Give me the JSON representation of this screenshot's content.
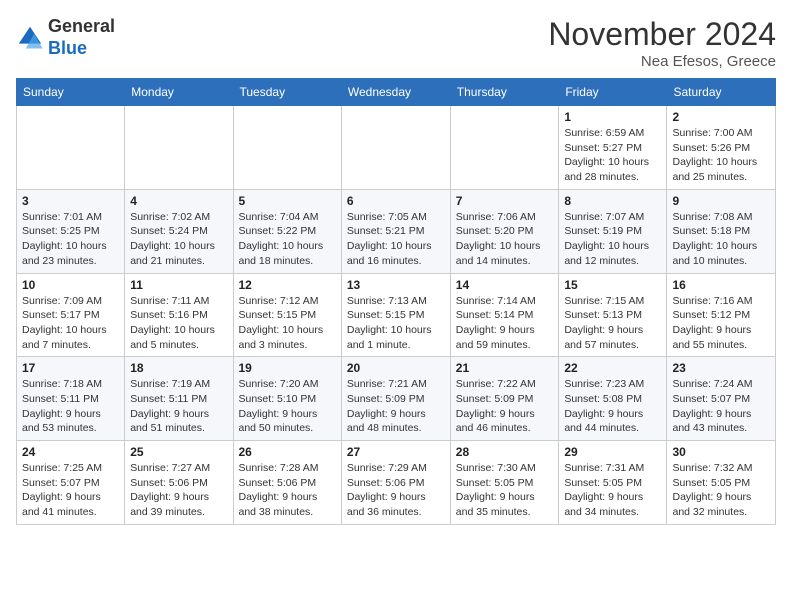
{
  "header": {
    "logo_general": "General",
    "logo_blue": "Blue",
    "month_title": "November 2024",
    "subtitle": "Nea Efesos, Greece"
  },
  "weekdays": [
    "Sunday",
    "Monday",
    "Tuesday",
    "Wednesday",
    "Thursday",
    "Friday",
    "Saturday"
  ],
  "weeks": [
    [
      {
        "day": "",
        "info": ""
      },
      {
        "day": "",
        "info": ""
      },
      {
        "day": "",
        "info": ""
      },
      {
        "day": "",
        "info": ""
      },
      {
        "day": "",
        "info": ""
      },
      {
        "day": "1",
        "info": "Sunrise: 6:59 AM\nSunset: 5:27 PM\nDaylight: 10 hours and 28 minutes."
      },
      {
        "day": "2",
        "info": "Sunrise: 7:00 AM\nSunset: 5:26 PM\nDaylight: 10 hours and 25 minutes."
      }
    ],
    [
      {
        "day": "3",
        "info": "Sunrise: 7:01 AM\nSunset: 5:25 PM\nDaylight: 10 hours and 23 minutes."
      },
      {
        "day": "4",
        "info": "Sunrise: 7:02 AM\nSunset: 5:24 PM\nDaylight: 10 hours and 21 minutes."
      },
      {
        "day": "5",
        "info": "Sunrise: 7:04 AM\nSunset: 5:22 PM\nDaylight: 10 hours and 18 minutes."
      },
      {
        "day": "6",
        "info": "Sunrise: 7:05 AM\nSunset: 5:21 PM\nDaylight: 10 hours and 16 minutes."
      },
      {
        "day": "7",
        "info": "Sunrise: 7:06 AM\nSunset: 5:20 PM\nDaylight: 10 hours and 14 minutes."
      },
      {
        "day": "8",
        "info": "Sunrise: 7:07 AM\nSunset: 5:19 PM\nDaylight: 10 hours and 12 minutes."
      },
      {
        "day": "9",
        "info": "Sunrise: 7:08 AM\nSunset: 5:18 PM\nDaylight: 10 hours and 10 minutes."
      }
    ],
    [
      {
        "day": "10",
        "info": "Sunrise: 7:09 AM\nSunset: 5:17 PM\nDaylight: 10 hours and 7 minutes."
      },
      {
        "day": "11",
        "info": "Sunrise: 7:11 AM\nSunset: 5:16 PM\nDaylight: 10 hours and 5 minutes."
      },
      {
        "day": "12",
        "info": "Sunrise: 7:12 AM\nSunset: 5:15 PM\nDaylight: 10 hours and 3 minutes."
      },
      {
        "day": "13",
        "info": "Sunrise: 7:13 AM\nSunset: 5:15 PM\nDaylight: 10 hours and 1 minute."
      },
      {
        "day": "14",
        "info": "Sunrise: 7:14 AM\nSunset: 5:14 PM\nDaylight: 9 hours and 59 minutes."
      },
      {
        "day": "15",
        "info": "Sunrise: 7:15 AM\nSunset: 5:13 PM\nDaylight: 9 hours and 57 minutes."
      },
      {
        "day": "16",
        "info": "Sunrise: 7:16 AM\nSunset: 5:12 PM\nDaylight: 9 hours and 55 minutes."
      }
    ],
    [
      {
        "day": "17",
        "info": "Sunrise: 7:18 AM\nSunset: 5:11 PM\nDaylight: 9 hours and 53 minutes."
      },
      {
        "day": "18",
        "info": "Sunrise: 7:19 AM\nSunset: 5:11 PM\nDaylight: 9 hours and 51 minutes."
      },
      {
        "day": "19",
        "info": "Sunrise: 7:20 AM\nSunset: 5:10 PM\nDaylight: 9 hours and 50 minutes."
      },
      {
        "day": "20",
        "info": "Sunrise: 7:21 AM\nSunset: 5:09 PM\nDaylight: 9 hours and 48 minutes."
      },
      {
        "day": "21",
        "info": "Sunrise: 7:22 AM\nSunset: 5:09 PM\nDaylight: 9 hours and 46 minutes."
      },
      {
        "day": "22",
        "info": "Sunrise: 7:23 AM\nSunset: 5:08 PM\nDaylight: 9 hours and 44 minutes."
      },
      {
        "day": "23",
        "info": "Sunrise: 7:24 AM\nSunset: 5:07 PM\nDaylight: 9 hours and 43 minutes."
      }
    ],
    [
      {
        "day": "24",
        "info": "Sunrise: 7:25 AM\nSunset: 5:07 PM\nDaylight: 9 hours and 41 minutes."
      },
      {
        "day": "25",
        "info": "Sunrise: 7:27 AM\nSunset: 5:06 PM\nDaylight: 9 hours and 39 minutes."
      },
      {
        "day": "26",
        "info": "Sunrise: 7:28 AM\nSunset: 5:06 PM\nDaylight: 9 hours and 38 minutes."
      },
      {
        "day": "27",
        "info": "Sunrise: 7:29 AM\nSunset: 5:06 PM\nDaylight: 9 hours and 36 minutes."
      },
      {
        "day": "28",
        "info": "Sunrise: 7:30 AM\nSunset: 5:05 PM\nDaylight: 9 hours and 35 minutes."
      },
      {
        "day": "29",
        "info": "Sunrise: 7:31 AM\nSunset: 5:05 PM\nDaylight: 9 hours and 34 minutes."
      },
      {
        "day": "30",
        "info": "Sunrise: 7:32 AM\nSunset: 5:05 PM\nDaylight: 9 hours and 32 minutes."
      }
    ]
  ]
}
